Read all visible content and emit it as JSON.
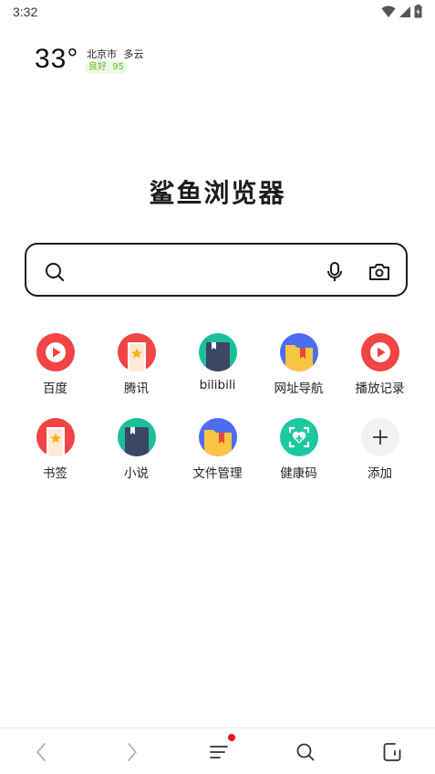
{
  "status_bar": {
    "time": "3:32"
  },
  "weather": {
    "temperature": "33°",
    "location": "北京市",
    "condition": "多云",
    "air_quality": "良好",
    "aqi": "95"
  },
  "brand": {
    "name": "鲨鱼浏览器"
  },
  "search": {
    "placeholder": ""
  },
  "shortcuts": [
    {
      "label": "百度",
      "icon": "play-icon",
      "color": "#f24444"
    },
    {
      "label": "腾讯",
      "icon": "bookmark-star-icon",
      "color": "#f24444"
    },
    {
      "label": "bilibili",
      "icon": "book-icon",
      "color": "#1cbf9c"
    },
    {
      "label": "网址导航",
      "icon": "folder-icon",
      "color": "#4c6df0"
    },
    {
      "label": "播放记录",
      "icon": "play-icon",
      "color": "#f24444"
    },
    {
      "label": "书签",
      "icon": "bookmark-star-icon",
      "color": "#f24444"
    },
    {
      "label": "小说",
      "icon": "book-icon",
      "color": "#1cbf9c"
    },
    {
      "label": "文件管理",
      "icon": "folder-icon",
      "color": "#4c6df0"
    },
    {
      "label": "健康码",
      "icon": "health-code-icon",
      "color": "#1cc8a0"
    },
    {
      "label": "添加",
      "icon": "plus-icon",
      "color": "#f2f2f2"
    }
  ],
  "bottom_nav": {
    "items": [
      "back-arrow-icon",
      "forward-arrow-icon",
      "menu-icon",
      "search-icon",
      "tabs-icon"
    ],
    "badge_color": "#e8141e"
  }
}
